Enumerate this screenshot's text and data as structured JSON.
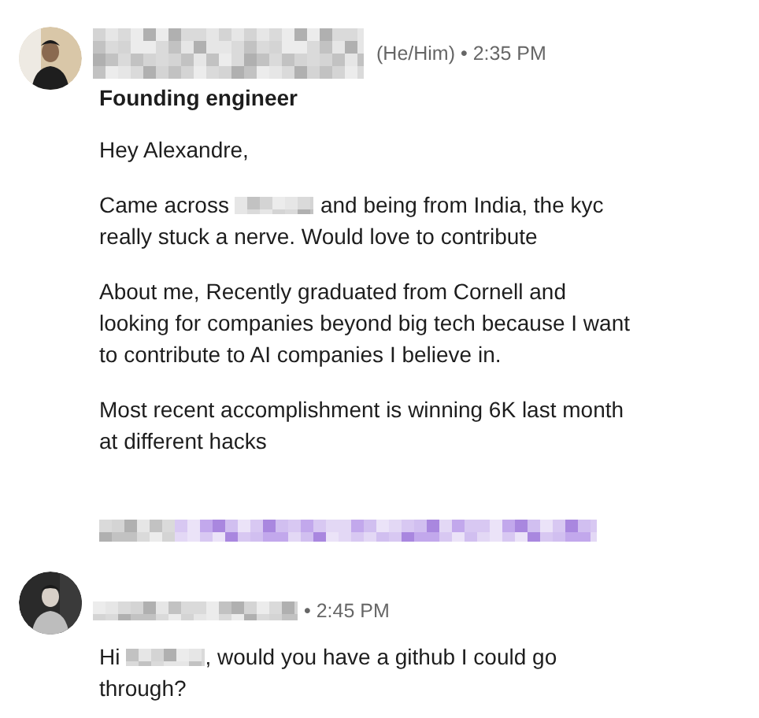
{
  "messages": [
    {
      "sender": {
        "kind": "redacted"
      },
      "meta": "(He/Him) • 2:35 PM",
      "subject": "Founding engineer",
      "avatar": {
        "kind": "picture"
      },
      "paragraphs": [
        [
          [
            {
              "kind": "text",
              "text": "Hey Alexandre,"
            }
          ]
        ],
        [
          [
            {
              "kind": "text",
              "text": "Came across"
            },
            {
              "kind": "redacted"
            },
            {
              "kind": "text",
              "text": "and being from India, the kyc"
            }
          ],
          [
            {
              "kind": "text",
              "text": "really stuck a nerve. Would love to contribute"
            }
          ]
        ],
        [
          [
            {
              "kind": "text",
              "text": "About me, Recently graduated from Cornell and"
            }
          ],
          [
            {
              "kind": "text",
              "text": "looking for companies beyond big tech because I want"
            }
          ],
          [
            {
              "kind": "text",
              "text": "to contribute to AI companies I believe in."
            }
          ]
        ],
        [
          [
            {
              "kind": "text",
              "text": "Most recent accomplishment is winning 6K last month"
            }
          ],
          [
            {
              "kind": "text",
              "text": "at different hacks"
            }
          ]
        ],
        [
          [
            {
              "kind": "redacted_link"
            }
          ]
        ]
      ]
    },
    {
      "sender": {
        "kind": "redacted"
      },
      "meta": "• 2:45 PM",
      "avatar": {
        "kind": "picture"
      },
      "paragraphs": [
        [
          [
            {
              "kind": "text",
              "text": "Hi"
            },
            {
              "kind": "redacted"
            },
            {
              "kind": "text",
              "text": ", would you have a github I could go"
            }
          ],
          [
            {
              "kind": "text",
              "text": "through?"
            }
          ]
        ]
      ]
    }
  ]
}
